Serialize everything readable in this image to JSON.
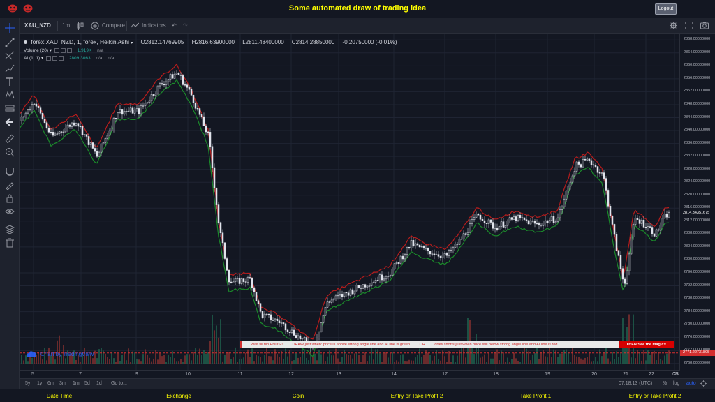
{
  "header": {
    "title": "Some automated draw of trading idea",
    "logout_label": "Logout"
  },
  "toolbar": {
    "symbol": "XAU_NZD",
    "interval": "1m",
    "compare_label": "Compare",
    "indicators_label": "Indicators"
  },
  "legend": {
    "symbol_line": "forex:XAU_NZD, 1, forex, Heikin Ashi",
    "open": "O2812.14769905",
    "high": "H2816.63900000",
    "low": "L2811.48400000",
    "close": "C2814.28850000",
    "change": "-0.20750000 (-0.01%)",
    "volume_label": "Volume (20)",
    "volume_value": "1.919K",
    "volume_na": "n/a",
    "ai_label": "AI (1, 1)",
    "ai_value": "2809.3063",
    "ai_na1": "n/a",
    "ai_na2": "n/a"
  },
  "watermark": "Chart by TradingView",
  "banner": {
    "part1": "Wait till flip ENDS !",
    "part2": "DRAW just when:  price is above strong angle line and AI line is green",
    "part3": "OR",
    "part4": "draw shorts just when price still below strong angle line and AI line is red",
    "magic": "THEN See the magic!!"
  },
  "price_axis": {
    "labels": [
      "2868.00000000",
      "2864.00000000",
      "2860.00000000",
      "2856.00000000",
      "2852.00000000",
      "2848.00000000",
      "2844.00000000",
      "2840.00000000",
      "2836.00000000",
      "2832.00000000",
      "2828.00000000",
      "2824.00000000",
      "2820.00000000",
      "2816.00000000",
      "2812.00000000",
      "2808.00000000",
      "2804.00000000",
      "2800.00000000",
      "2796.00000000",
      "2792.00000000",
      "2788.00000000",
      "2784.00000000",
      "2780.00000000",
      "2776.00000000",
      "2772.00000000",
      "2768.00000000"
    ],
    "last_price": "2814.34351675",
    "line_price": "2771.22731805"
  },
  "time_axis": {
    "labels": [
      "5",
      "7",
      "9",
      "10",
      "11",
      "12",
      "13",
      "14",
      "17",
      "18",
      "19",
      "20",
      "21",
      "22",
      "23",
      "08:"
    ]
  },
  "range_bar": {
    "items": [
      "5y",
      "1y",
      "6m",
      "3m",
      "1m",
      "5d",
      "1d",
      "Go to..."
    ],
    "clock": "07:18:13 (UTC)",
    "percent": "%",
    "log": "log",
    "auto": "auto"
  },
  "footer": {
    "columns": [
      "Date Time",
      "Exchange",
      "Coin",
      "Entry or Take Profit 2",
      "Take Profit 1",
      "Entry or Take Profit 2"
    ]
  },
  "colors": {
    "background": "#131722",
    "up_candle": "#e0e3eb",
    "down_candle": "#e0e3eb",
    "red_line": "#b71c1c",
    "green_line": "#1b8a2a",
    "volume_green": "#1f5c4a",
    "volume_red": "#7a2e2e",
    "title_yellow": "#ffff00"
  },
  "chart_data": {
    "type": "candlestick",
    "y_range": [
      2766,
      2870
    ],
    "key_closes": [
      {
        "x": 0,
        "y": 2843
      },
      {
        "x": 20,
        "y": 2849
      },
      {
        "x": 45,
        "y": 2838
      },
      {
        "x": 80,
        "y": 2843
      },
      {
        "x": 110,
        "y": 2832
      },
      {
        "x": 140,
        "y": 2846
      },
      {
        "x": 170,
        "y": 2846
      },
      {
        "x": 200,
        "y": 2854
      },
      {
        "x": 225,
        "y": 2858
      },
      {
        "x": 245,
        "y": 2851
      },
      {
        "x": 270,
        "y": 2838
      },
      {
        "x": 285,
        "y": 2810
      },
      {
        "x": 300,
        "y": 2793
      },
      {
        "x": 330,
        "y": 2794
      },
      {
        "x": 345,
        "y": 2783
      },
      {
        "x": 370,
        "y": 2781
      },
      {
        "x": 400,
        "y": 2776
      },
      {
        "x": 420,
        "y": 2773
      },
      {
        "x": 440,
        "y": 2787
      },
      {
        "x": 470,
        "y": 2790
      },
      {
        "x": 500,
        "y": 2793
      },
      {
        "x": 530,
        "y": 2796
      },
      {
        "x": 560,
        "y": 2805
      },
      {
        "x": 580,
        "y": 2803
      },
      {
        "x": 610,
        "y": 2801
      },
      {
        "x": 630,
        "y": 2806
      },
      {
        "x": 655,
        "y": 2814
      },
      {
        "x": 680,
        "y": 2810
      },
      {
        "x": 710,
        "y": 2813
      },
      {
        "x": 740,
        "y": 2811
      },
      {
        "x": 770,
        "y": 2813
      },
      {
        "x": 795,
        "y": 2829
      },
      {
        "x": 815,
        "y": 2831
      },
      {
        "x": 835,
        "y": 2826
      },
      {
        "x": 850,
        "y": 2808
      },
      {
        "x": 865,
        "y": 2792
      },
      {
        "x": 880,
        "y": 2813
      },
      {
        "x": 895,
        "y": 2811
      },
      {
        "x": 910,
        "y": 2808
      },
      {
        "x": 925,
        "y": 2814
      }
    ]
  }
}
